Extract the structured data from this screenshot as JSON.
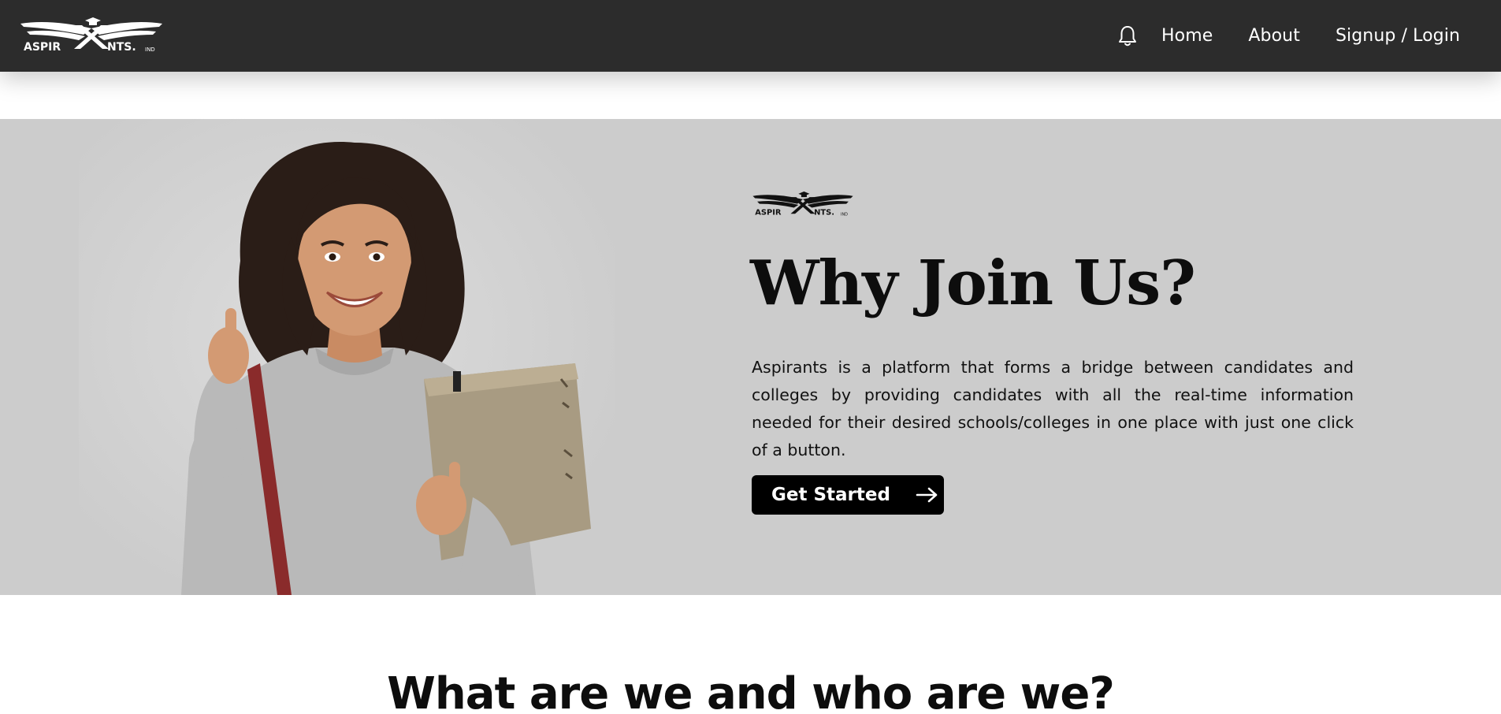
{
  "brand": {
    "logo_text_left": "ASPIR",
    "logo_text_right": "NTS.",
    "logo_suffix": "IND"
  },
  "nav": {
    "bell_icon": "bell-icon",
    "links": [
      {
        "label": "Home"
      },
      {
        "label": "About"
      },
      {
        "label": "Signup / Login"
      }
    ]
  },
  "hero": {
    "title": "Why Join Us?",
    "description": "Aspirants is a platform that forms a bridge between candidates and colleges by providing candidates with all the real-time information needed for their desired schools/colleges in one place with just one click of a button.",
    "cta_label": "Get Started",
    "cta_icon": "arrow-right-icon",
    "background_color": "#cccccc"
  },
  "section": {
    "title": "What are we and who are we?"
  },
  "colors": {
    "navbar": "#2c2c2c",
    "cta_bg": "#000000",
    "text": "#0d0d0d"
  }
}
